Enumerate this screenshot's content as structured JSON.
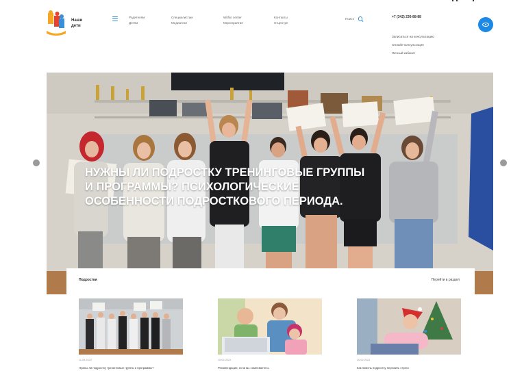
{
  "header": {
    "logo_text_line1": "Наши",
    "logo_text_line2": "дети",
    "nav": [
      {
        "line1": "Родителям",
        "line2": "Детям"
      },
      {
        "line1": "Специалистам",
        "line2": "Медиатеке"
      },
      {
        "line1": "Within center",
        "line2": "Мероприятия"
      },
      {
        "line1": "Контакты",
        "line2": "О Центре"
      }
    ],
    "search_label": "Поиск",
    "phone": "+7 (342) 236-88-88",
    "links": [
      "Записаться на консультацию",
      "Онлайн-консультация",
      "Личный кабинет"
    ]
  },
  "hero": {
    "title": "Нужны ли подростку тренинговые группы и программы? Психологические особенности подросткового периода."
  },
  "news": {
    "heading": "Подростки",
    "all_link": "Перейти в раздел",
    "items": [
      {
        "date": "11.09.2023",
        "title": "Нужны ли подростку тренинговые группы и программы?"
      },
      {
        "date": "15.09.2023",
        "title": "Рекомендации, если вы сомневаетесь"
      },
      {
        "date": "20.09.2023",
        "title": "Как помочь подростку пережить стресс"
      }
    ]
  },
  "colors": {
    "accent": "#1e88e5",
    "logo_orange": "#f5a623",
    "logo_red": "#e8412c",
    "logo_blue": "#3a8fd9"
  }
}
